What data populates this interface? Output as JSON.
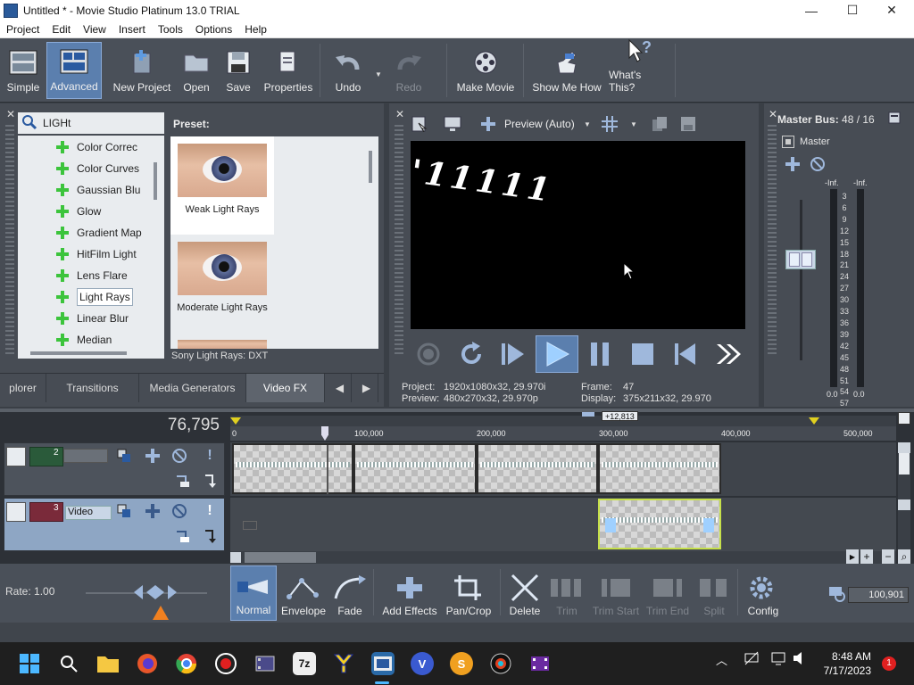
{
  "window": {
    "title": "Untitled * - Movie Studio Platinum 13.0 TRIAL",
    "minimize": "—",
    "maximize": "☐",
    "close": "✕"
  },
  "menu": [
    "Project",
    "Edit",
    "View",
    "Insert",
    "Tools",
    "Options",
    "Help"
  ],
  "toolbar": {
    "simple": "Simple",
    "advanced": "Advanced",
    "new_project": "New Project",
    "open": "Open",
    "save": "Save",
    "properties": "Properties",
    "undo": "Undo",
    "redo": "Redo",
    "make_movie": "Make Movie",
    "show_me_how": "Show Me How",
    "whats_this": "What's This?"
  },
  "explorer": {
    "search_value": "LIGHt",
    "fx_items": [
      "Color Correc",
      "Color Curves",
      "Gaussian Blu",
      "Glow",
      "Gradient Map",
      "HitFilm Light",
      "Lens Flare",
      "Light Rays",
      "Linear Blur",
      "Median"
    ],
    "selected_item": "Light Rays",
    "preset_label": "Preset:",
    "presets": [
      "Weak Light Rays",
      "Moderate Light Rays"
    ],
    "preset_footer": "Sony Light Rays: DXT",
    "tabs": [
      "plorer",
      "Transitions",
      "Media Generators",
      "Video FX"
    ],
    "active_tab": "Video FX"
  },
  "preview": {
    "mode": "Preview (Auto)",
    "overlay_text": "'11111",
    "project_label": "Project:",
    "project_value": "1920x1080x32, 29.970i",
    "preview_label": "Preview:",
    "preview_value": "480x270x32, 29.970p",
    "frame_label": "Frame:",
    "frame_value": "47",
    "display_label": "Display:",
    "display_value": "375x211x32, 29.970"
  },
  "master": {
    "title": "Master Bus:",
    "value": "48 / 16",
    "channel_label": "Master",
    "peak_left": "-Inf.",
    "peak_right": "-Inf.",
    "scale": [
      "3",
      "6",
      "9",
      "12",
      "15",
      "18",
      "21",
      "24",
      "27",
      "30",
      "33",
      "36",
      "39",
      "42",
      "45",
      "48",
      "51",
      "54",
      "57"
    ],
    "bottom_left": "0.0",
    "bottom_right": "0.0"
  },
  "timeline": {
    "time_display": "76,795",
    "cursor_badge": "+12,813",
    "ruler_marks": [
      "0",
      "100,000",
      "200,000",
      "300,000",
      "400,000",
      "500,000"
    ],
    "tracks": [
      {
        "number": "2",
        "name": ""
      },
      {
        "number": "3",
        "name": "Video"
      }
    ],
    "rate": "Rate: 1.00"
  },
  "edit_toolbar": {
    "normal": "Normal",
    "envelope": "Envelope",
    "fade": "Fade",
    "add_effects": "Add Effects",
    "pan_crop": "Pan/Crop",
    "delete": "Delete",
    "trim": "Trim",
    "trim_start": "Trim Start",
    "trim_end": "Trim End",
    "split": "Split",
    "config": "Config",
    "zoom_value": "100,901"
  },
  "taskbar": {
    "time": "8:48 AM",
    "date": "7/17/2023",
    "notification_count": "1",
    "apps": [
      "7z",
      "V",
      "S"
    ]
  },
  "colors": {
    "accent": "#5b7fae",
    "fx_plus": "#3cc43c",
    "clip_highlight": "#c6e04a"
  }
}
